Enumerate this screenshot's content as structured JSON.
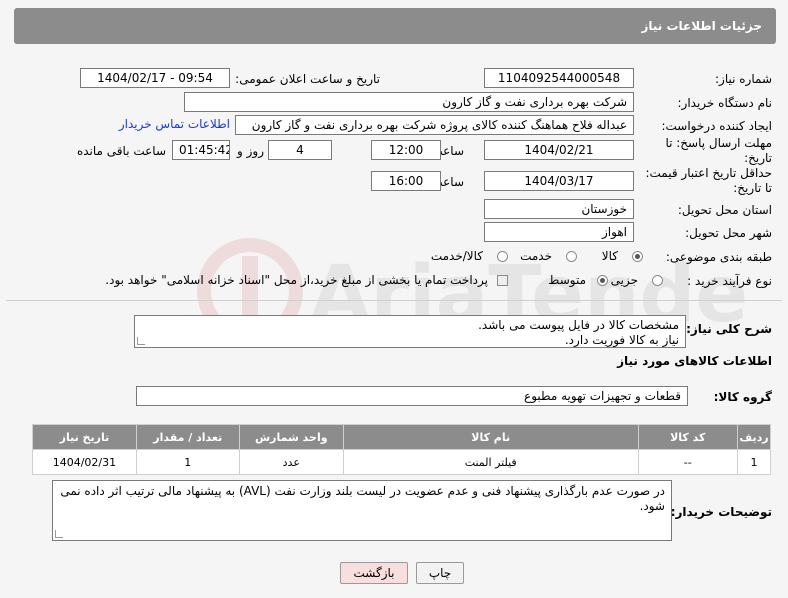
{
  "header": {
    "title": "جزئیات اطلاعات نیاز"
  },
  "fields": {
    "need_number": {
      "label": "شماره نیاز:",
      "value": "1104092544000548"
    },
    "announce_datetime": {
      "label": "تاریخ و ساعت اعلان عمومی:",
      "value": "1404/02/17 - 09:54"
    },
    "buyer_org": {
      "label": "نام دستگاه خریدار:",
      "value": "شرکت بهره برداری نفت و گاز کارون"
    },
    "requester": {
      "label": "ایجاد کننده درخواست:",
      "value": "عبداله فلاح هماهنگ کننده کالای پروژه شرکت بهره برداری نفت و گاز کارون",
      "contact_link": "اطلاعات تماس خریدار"
    },
    "reply_deadline": {
      "label": "مهلت ارسال پاسخ: تا تاریخ:",
      "date": "1404/02/21",
      "time_label": "ساعت",
      "time": "12:00",
      "days": "4",
      "days_label": "روز و",
      "remaining": "01:45:42",
      "remaining_label": "ساعت باقی مانده"
    },
    "price_validity": {
      "label": "حداقل تاریخ اعتبار قیمت: تا تاریخ:",
      "date": "1404/03/17",
      "time_label": "ساعت",
      "time": "16:00"
    },
    "delivery_province": {
      "label": "استان محل تحویل:",
      "value": "خوزستان"
    },
    "delivery_city": {
      "label": "شهر محل تحویل:",
      "value": "اهواز"
    },
    "category": {
      "label": "طبقه بندی موضوعی:",
      "options": [
        "کالا",
        "خدمت",
        "کالا/خدمت"
      ],
      "selected": "کالا"
    },
    "process_type": {
      "label": "نوع فرآیند خرید :",
      "options": [
        "جزیی",
        "متوسط"
      ],
      "selected": "متوسط",
      "note": "پرداخت تمام یا بخشی از مبلغ خرید،از محل \"اسناد خزانه اسلامی\" خواهد بود."
    }
  },
  "description": {
    "label": "شرح کلی نیاز:",
    "line1": "مشخصات کالا در فایل پیوست می باشد.",
    "line2": "نیاز به کالا فوریت دارد."
  },
  "goods_section": {
    "title": "اطلاعات کالاهای مورد نیاز",
    "group_label": "گروه کالا:",
    "group_value": "قطعات و تجهیزات تهویه مطبوع"
  },
  "table": {
    "headers": [
      "ردیف",
      "کد کالا",
      "نام کالا",
      "واحد شمارش",
      "تعداد / مقدار",
      "تاریخ نیاز"
    ],
    "rows": [
      [
        "1",
        "--",
        "فیلتر المنت",
        "عدد",
        "1",
        "1404/02/31"
      ]
    ]
  },
  "buyer_notes": {
    "label": "توضیحات خریدار:",
    "text": "در صورت عدم بارگذاری پیشنهاد فنی و عدم عضویت در لیست بلند وزارت نفت (AVL) به پیشنهاد مالی ترتیب اثر داده نمی شود."
  },
  "buttons": {
    "print": "چاپ",
    "back": "بازگشت"
  },
  "watermark": {
    "text": "AriaTender.neT"
  },
  "colors": {
    "header_bg": "#8c8c8c",
    "link": "#1a3ccf",
    "back_button_bg": "#f8dede"
  }
}
